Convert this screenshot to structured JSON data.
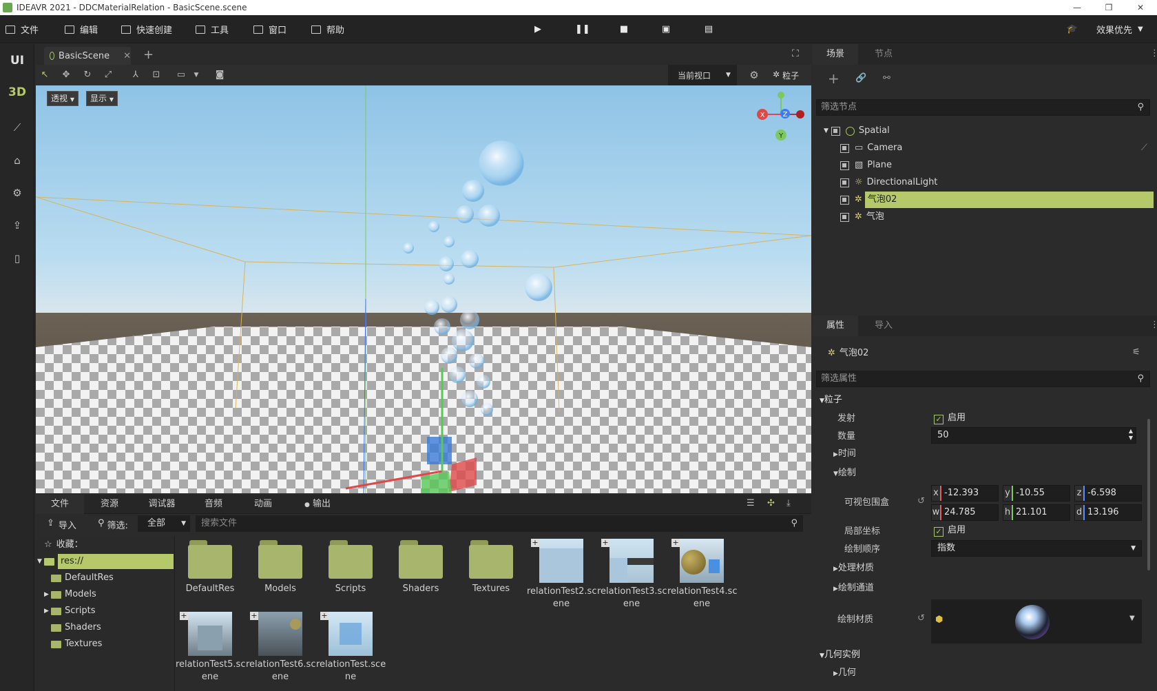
{
  "window": {
    "title": "IDEAVR 2021 - DDCMaterialRelation - BasicScene.scene"
  },
  "menu": [
    {
      "label": "文件",
      "icon": "folder-icon"
    },
    {
      "label": "编辑",
      "icon": "crop-icon"
    },
    {
      "label": "快速创建",
      "icon": "edit-icon"
    },
    {
      "label": "工具",
      "icon": "window-icon"
    },
    {
      "label": "窗口",
      "icon": "frame-icon"
    },
    {
      "label": "帮助",
      "icon": "book-icon"
    }
  ],
  "toolbar": {
    "quality_label": "效果优先"
  },
  "rail": {
    "ui_label": "UI",
    "three_d_label": "3D"
  },
  "scene_tab": {
    "label": "BasicScene"
  },
  "viewport": {
    "view_select": "当前视口",
    "particles_label": "粒子",
    "perspective_button": "透视",
    "display_button": "显示",
    "gizmo": {
      "x": "X",
      "y": "Y",
      "z": "Z"
    }
  },
  "dock": {
    "tabs": [
      "文件",
      "资源",
      "调试器",
      "音频",
      "动画",
      "输出"
    ],
    "import_label": "导入",
    "filter_label": "筛选:",
    "filter_value": "全部",
    "search_placeholder": "搜索文件",
    "favorites_label": "收藏：",
    "tree": [
      {
        "label": "res://",
        "depth": 0,
        "selected": true
      },
      {
        "label": "DefaultRes",
        "depth": 1
      },
      {
        "label": "Models",
        "depth": 1
      },
      {
        "label": "Scripts",
        "depth": 1
      },
      {
        "label": "Shaders",
        "depth": 1
      },
      {
        "label": "Textures",
        "depth": 1
      }
    ],
    "files": [
      {
        "name": "DefaultRes",
        "kind": "folder"
      },
      {
        "name": "Models",
        "kind": "folder"
      },
      {
        "name": "Scripts",
        "kind": "folder"
      },
      {
        "name": "Shaders",
        "kind": "folder"
      },
      {
        "name": "Textures",
        "kind": "folder"
      },
      {
        "name": "relationTest2.scene",
        "kind": "scene",
        "line1": "relationTest2.sc",
        "line2": "ene"
      },
      {
        "name": "relationTest3.scene",
        "kind": "scene",
        "line1": "relationTest3.sc",
        "line2": "ene"
      },
      {
        "name": "relationTest4.scene",
        "kind": "scene",
        "line1": "relationTest4.sc",
        "line2": "ene"
      },
      {
        "name": "relationTest5.scene",
        "kind": "scene",
        "line1": "relationTest5.sc",
        "line2": "ene"
      },
      {
        "name": "relationTest6.scene",
        "kind": "scene",
        "line1": "relationTest6.sc",
        "line2": "ene"
      },
      {
        "name": "relationTest.scene",
        "kind": "scene",
        "line1": "relationTest.sce",
        "line2": "ne"
      }
    ]
  },
  "scene_panel": {
    "tabs": [
      "场景",
      "节点"
    ],
    "filter_placeholder": "筛选节点",
    "nodes": [
      {
        "label": "Spatial",
        "depth": 0,
        "icon": "spatial-icon"
      },
      {
        "label": "Camera",
        "depth": 1,
        "icon": "camera-icon"
      },
      {
        "label": "Plane",
        "depth": 1,
        "icon": "plane-icon"
      },
      {
        "label": "DirectionalLight",
        "depth": 1,
        "icon": "light-icon"
      },
      {
        "label": "气泡02",
        "depth": 1,
        "icon": "particles-icon",
        "selected": true
      },
      {
        "label": "气泡",
        "depth": 1,
        "icon": "particles-icon"
      }
    ]
  },
  "props_panel": {
    "tabs": [
      "属性",
      "导入"
    ],
    "node_name": "气泡02",
    "filter_placeholder": "筛选属性",
    "particles_section": "粒子",
    "emit_label": "发射",
    "emit_value": "启用",
    "amount_label": "数量",
    "amount_value": "50",
    "time_section": "时间",
    "draw_section": "绘制",
    "aabb_label": "可视包围盒",
    "aabb": {
      "x": "-12.393",
      "y": "-10.55",
      "z": "-6.598",
      "w": "24.785",
      "h": "21.101",
      "d": "13.196"
    },
    "local_coords_label": "局部坐标",
    "local_coords_value": "启用",
    "draw_order_label": "绘制顺序",
    "draw_order_value": "指数",
    "process_material_section": "处理材质",
    "draw_passes_section": "绘制通道",
    "draw_material_label": "绘制材质",
    "geometry_section": "几何实例",
    "geometry_sub": "几何"
  },
  "colors": {
    "accent": "#b5c96a",
    "panel_bg": "#2b2b2b",
    "sky": "#9ccbe6"
  }
}
